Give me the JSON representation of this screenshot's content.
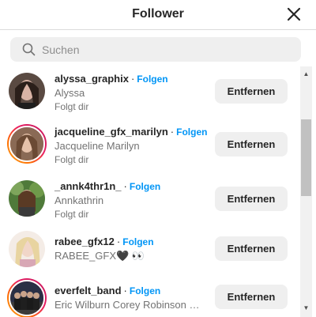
{
  "header": {
    "title": "Follower",
    "close_icon": "close-icon"
  },
  "search": {
    "placeholder": "Suchen",
    "value": "",
    "icon": "search-icon"
  },
  "followers": [
    {
      "username": "alyssa_graphix",
      "separator": "·",
      "follow_label": "Folgen",
      "full_name": "Alyssa",
      "subtitle": "Folgt dir",
      "remove_label": "Entfernen",
      "story_ring": false
    },
    {
      "username": "jacqueline_gfx_marilyn",
      "separator": "·",
      "follow_label": "Folgen",
      "full_name": "Jacqueline Marilyn",
      "subtitle": "Folgt dir",
      "remove_label": "Entfernen",
      "story_ring": true
    },
    {
      "username": "_annk4thr1n_",
      "separator": "·",
      "follow_label": "Folgen",
      "full_name": "Annkathrin",
      "subtitle": "Folgt dir",
      "remove_label": "Entfernen",
      "story_ring": false
    },
    {
      "username": "rabee_gfx12",
      "separator": "·",
      "follow_label": "Folgen",
      "full_name": "RABEE_GFX🖤 👀",
      "subtitle": "",
      "remove_label": "Entfernen",
      "story_ring": false
    },
    {
      "username": "everfelt_band",
      "separator": "·",
      "follow_label": "Folgen",
      "full_name": "Eric Wilburn Corey Robinson …",
      "subtitle": "",
      "remove_label": "Entfernen",
      "story_ring": true
    }
  ],
  "colors": {
    "accent": "#0095f6",
    "button_bg": "#efefef",
    "text": "#262626",
    "muted": "#737373"
  }
}
